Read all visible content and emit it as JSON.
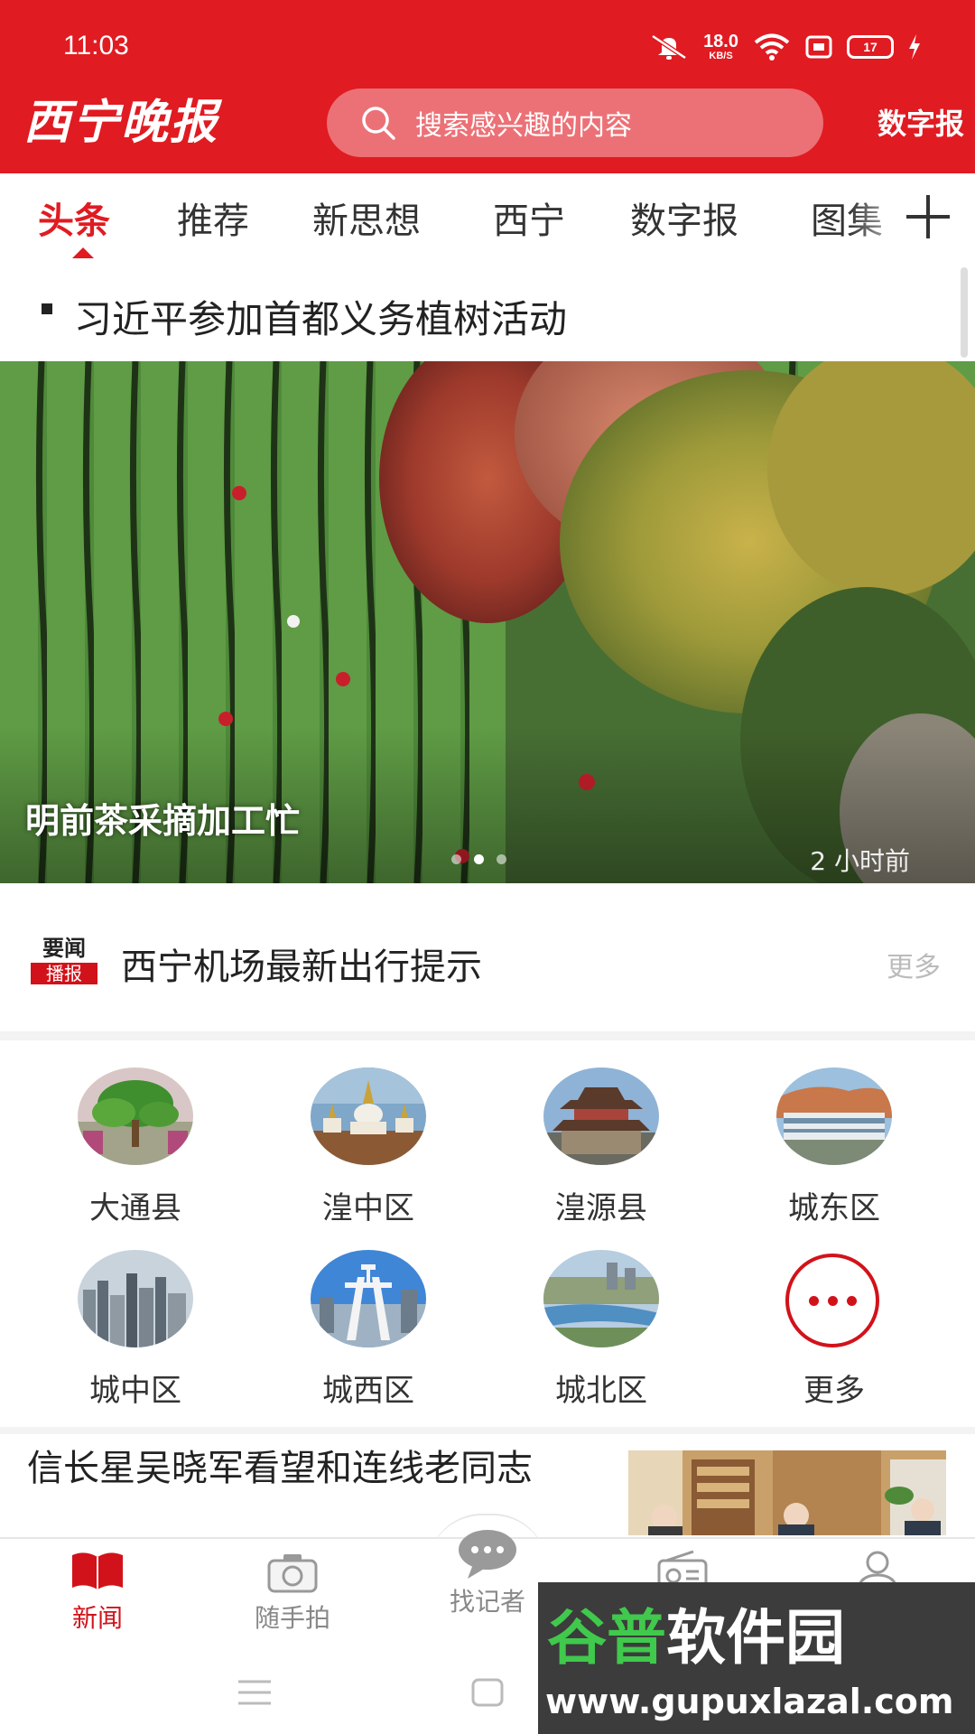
{
  "status_bar": {
    "time": "11:03",
    "net_speed_value": "18.0",
    "net_speed_unit": "KB/S",
    "battery": "17"
  },
  "header": {
    "logo_text": "西宁晚报",
    "search_placeholder": "搜索感兴趣的内容",
    "digital_link": "数字报"
  },
  "tabs": [
    "头条",
    "推荐",
    "新思想",
    "西宁",
    "数字报",
    "图集"
  ],
  "active_tab": "头条",
  "ticker": {
    "text": "习近平参加首都义务植树活动"
  },
  "banner": {
    "title": "明前茶采摘加工忙",
    "time": "2 小时前",
    "page_count": 3,
    "active_page": 2
  },
  "news_flash": {
    "logo_top": "要闻",
    "logo_bottom": "播报",
    "text": "西宁机场最新出行提示",
    "more": "更多"
  },
  "districts": [
    {
      "label": "大通县",
      "icon": "tree-photo"
    },
    {
      "label": "湟中区",
      "icon": "stupa-photo"
    },
    {
      "label": "湟源县",
      "icon": "tower-photo"
    },
    {
      "label": "城东区",
      "icon": "station-photo"
    },
    {
      "label": "城中区",
      "icon": "city-photo"
    },
    {
      "label": "城西区",
      "icon": "arch-photo"
    },
    {
      "label": "城北区",
      "icon": "river-photo"
    },
    {
      "label": "更多",
      "icon": "more-dots-icon"
    }
  ],
  "article": {
    "title": "信长星吴晓军看望和连线老同志"
  },
  "bottom_nav": [
    {
      "label": "新闻",
      "icon": "newspaper-icon",
      "active": true
    },
    {
      "label": "随手拍",
      "icon": "camera-icon",
      "active": false
    },
    {
      "label": "找记者",
      "icon": "chat-bubble-icon",
      "active": false
    },
    {
      "label": "视听",
      "icon": "radio-icon",
      "active": false
    },
    {
      "label": "我的",
      "icon": "user-icon",
      "active": false
    }
  ],
  "watermark": {
    "title_green": "谷普",
    "title_white": "软件园",
    "url": "www.gupuxlazal.com"
  },
  "colors": {
    "brand_red": "#e01b22",
    "accent_red": "#d2121a",
    "watermark_green": "#40c94c"
  }
}
